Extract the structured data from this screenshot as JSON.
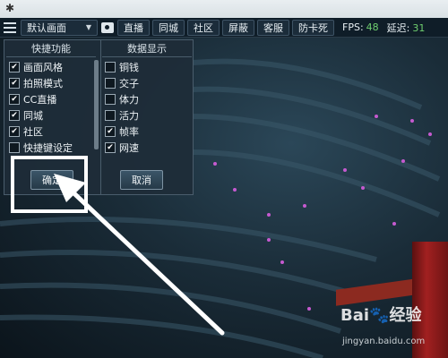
{
  "toolbar": {
    "select_value": "默认画面",
    "buttons": [
      "直播",
      "同城",
      "社区",
      "屏蔽",
      "客服",
      "防卡死"
    ],
    "fps_label": "FPS:",
    "fps_value": "48",
    "latency_label": "延迟:",
    "latency_value": "31"
  },
  "panel": {
    "left_header": "快捷功能",
    "right_header": "数据显示",
    "left_items": [
      {
        "label": "画面风格",
        "checked": true
      },
      {
        "label": "拍照模式",
        "checked": true
      },
      {
        "label": "CC直播",
        "checked": true
      },
      {
        "label": "同城",
        "checked": true
      },
      {
        "label": "社区",
        "checked": true
      },
      {
        "label": "快捷键设定",
        "checked": false
      }
    ],
    "right_items": [
      {
        "label": "铜钱",
        "checked": false
      },
      {
        "label": "交子",
        "checked": false
      },
      {
        "label": "体力",
        "checked": false
      },
      {
        "label": "活力",
        "checked": false
      },
      {
        "label": "帧率",
        "checked": true
      },
      {
        "label": "网速",
        "checked": true
      }
    ],
    "confirm_label": "确定",
    "cancel_label": "取消"
  },
  "watermark": {
    "brand": "Bai🐾经验",
    "url": "jingyan.baidu.com"
  },
  "colors": {
    "toolbar_bg": "#0f1d28",
    "panel_bg": "#1e2c38",
    "fps_green": "#6fcf6f",
    "highlight": "#ffffff"
  }
}
